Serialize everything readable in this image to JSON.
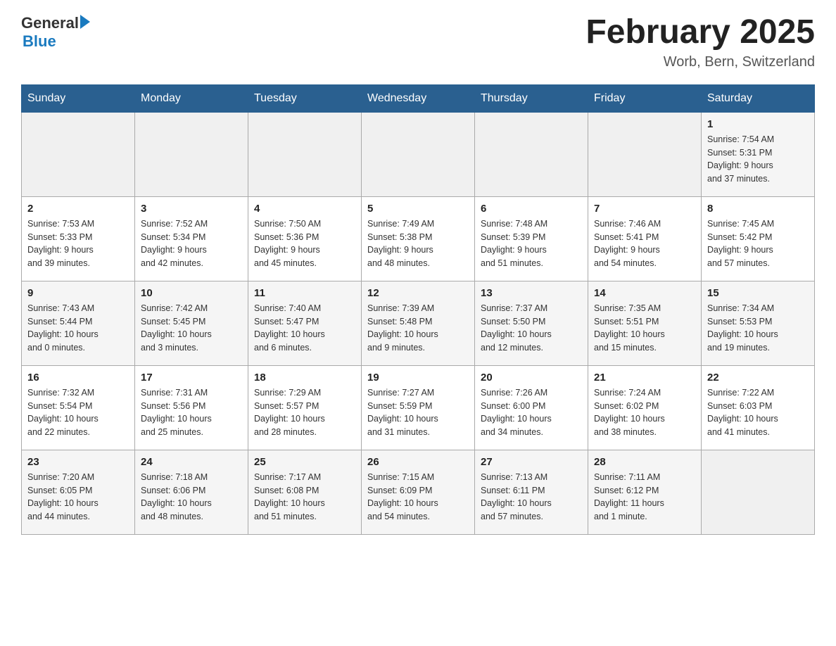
{
  "header": {
    "logo_general": "General",
    "logo_blue": "Blue",
    "month_title": "February 2025",
    "location": "Worb, Bern, Switzerland"
  },
  "days_of_week": [
    "Sunday",
    "Monday",
    "Tuesday",
    "Wednesday",
    "Thursday",
    "Friday",
    "Saturday"
  ],
  "weeks": [
    {
      "days": [
        {
          "num": "",
          "info": ""
        },
        {
          "num": "",
          "info": ""
        },
        {
          "num": "",
          "info": ""
        },
        {
          "num": "",
          "info": ""
        },
        {
          "num": "",
          "info": ""
        },
        {
          "num": "",
          "info": ""
        },
        {
          "num": "1",
          "info": "Sunrise: 7:54 AM\nSunset: 5:31 PM\nDaylight: 9 hours\nand 37 minutes."
        }
      ]
    },
    {
      "days": [
        {
          "num": "2",
          "info": "Sunrise: 7:53 AM\nSunset: 5:33 PM\nDaylight: 9 hours\nand 39 minutes."
        },
        {
          "num": "3",
          "info": "Sunrise: 7:52 AM\nSunset: 5:34 PM\nDaylight: 9 hours\nand 42 minutes."
        },
        {
          "num": "4",
          "info": "Sunrise: 7:50 AM\nSunset: 5:36 PM\nDaylight: 9 hours\nand 45 minutes."
        },
        {
          "num": "5",
          "info": "Sunrise: 7:49 AM\nSunset: 5:38 PM\nDaylight: 9 hours\nand 48 minutes."
        },
        {
          "num": "6",
          "info": "Sunrise: 7:48 AM\nSunset: 5:39 PM\nDaylight: 9 hours\nand 51 minutes."
        },
        {
          "num": "7",
          "info": "Sunrise: 7:46 AM\nSunset: 5:41 PM\nDaylight: 9 hours\nand 54 minutes."
        },
        {
          "num": "8",
          "info": "Sunrise: 7:45 AM\nSunset: 5:42 PM\nDaylight: 9 hours\nand 57 minutes."
        }
      ]
    },
    {
      "days": [
        {
          "num": "9",
          "info": "Sunrise: 7:43 AM\nSunset: 5:44 PM\nDaylight: 10 hours\nand 0 minutes."
        },
        {
          "num": "10",
          "info": "Sunrise: 7:42 AM\nSunset: 5:45 PM\nDaylight: 10 hours\nand 3 minutes."
        },
        {
          "num": "11",
          "info": "Sunrise: 7:40 AM\nSunset: 5:47 PM\nDaylight: 10 hours\nand 6 minutes."
        },
        {
          "num": "12",
          "info": "Sunrise: 7:39 AM\nSunset: 5:48 PM\nDaylight: 10 hours\nand 9 minutes."
        },
        {
          "num": "13",
          "info": "Sunrise: 7:37 AM\nSunset: 5:50 PM\nDaylight: 10 hours\nand 12 minutes."
        },
        {
          "num": "14",
          "info": "Sunrise: 7:35 AM\nSunset: 5:51 PM\nDaylight: 10 hours\nand 15 minutes."
        },
        {
          "num": "15",
          "info": "Sunrise: 7:34 AM\nSunset: 5:53 PM\nDaylight: 10 hours\nand 19 minutes."
        }
      ]
    },
    {
      "days": [
        {
          "num": "16",
          "info": "Sunrise: 7:32 AM\nSunset: 5:54 PM\nDaylight: 10 hours\nand 22 minutes."
        },
        {
          "num": "17",
          "info": "Sunrise: 7:31 AM\nSunset: 5:56 PM\nDaylight: 10 hours\nand 25 minutes."
        },
        {
          "num": "18",
          "info": "Sunrise: 7:29 AM\nSunset: 5:57 PM\nDaylight: 10 hours\nand 28 minutes."
        },
        {
          "num": "19",
          "info": "Sunrise: 7:27 AM\nSunset: 5:59 PM\nDaylight: 10 hours\nand 31 minutes."
        },
        {
          "num": "20",
          "info": "Sunrise: 7:26 AM\nSunset: 6:00 PM\nDaylight: 10 hours\nand 34 minutes."
        },
        {
          "num": "21",
          "info": "Sunrise: 7:24 AM\nSunset: 6:02 PM\nDaylight: 10 hours\nand 38 minutes."
        },
        {
          "num": "22",
          "info": "Sunrise: 7:22 AM\nSunset: 6:03 PM\nDaylight: 10 hours\nand 41 minutes."
        }
      ]
    },
    {
      "days": [
        {
          "num": "23",
          "info": "Sunrise: 7:20 AM\nSunset: 6:05 PM\nDaylight: 10 hours\nand 44 minutes."
        },
        {
          "num": "24",
          "info": "Sunrise: 7:18 AM\nSunset: 6:06 PM\nDaylight: 10 hours\nand 48 minutes."
        },
        {
          "num": "25",
          "info": "Sunrise: 7:17 AM\nSunset: 6:08 PM\nDaylight: 10 hours\nand 51 minutes."
        },
        {
          "num": "26",
          "info": "Sunrise: 7:15 AM\nSunset: 6:09 PM\nDaylight: 10 hours\nand 54 minutes."
        },
        {
          "num": "27",
          "info": "Sunrise: 7:13 AM\nSunset: 6:11 PM\nDaylight: 10 hours\nand 57 minutes."
        },
        {
          "num": "28",
          "info": "Sunrise: 7:11 AM\nSunset: 6:12 PM\nDaylight: 11 hours\nand 1 minute."
        },
        {
          "num": "",
          "info": ""
        }
      ]
    }
  ]
}
